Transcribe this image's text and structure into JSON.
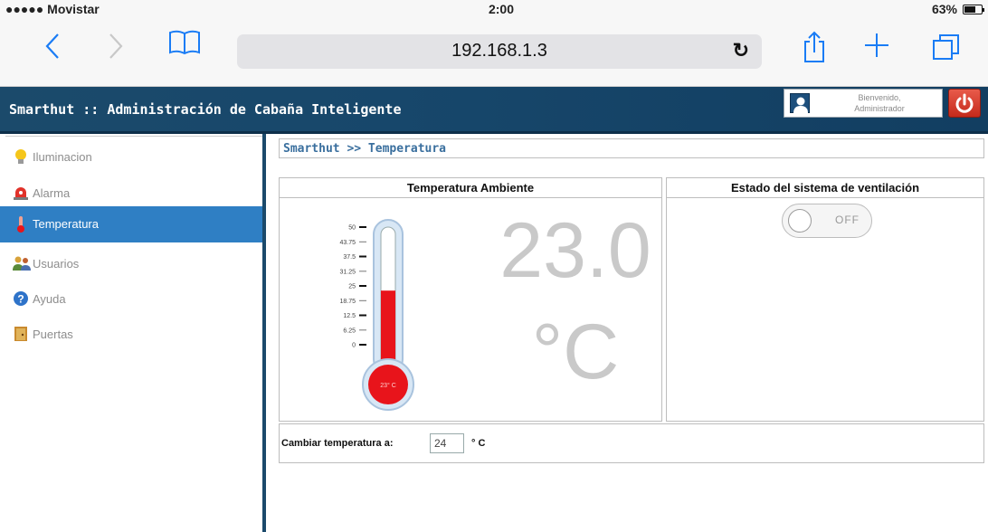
{
  "status": {
    "carrier": "●●●●● Movistar",
    "time": "2:00",
    "battery": "63%"
  },
  "browser": {
    "url": "192.168.1.3"
  },
  "header": {
    "title": "Smarthut :: Administración de Cabaña Inteligente",
    "welcome": "Bienvenido,",
    "user": "Administrador"
  },
  "sidebar": {
    "items": [
      {
        "label": "Iluminacion",
        "icon": "lightbulb-icon"
      },
      {
        "label": "Alarma",
        "icon": "alarm-icon"
      },
      {
        "label": "Temperatura",
        "icon": "thermometer-icon",
        "active": true
      },
      {
        "label": "Usuarios",
        "icon": "users-icon"
      },
      {
        "label": "Ayuda",
        "icon": "help-icon"
      },
      {
        "label": "Puertas",
        "icon": "door-icon"
      }
    ]
  },
  "breadcrumb": "Smarthut >> Temperatura",
  "temperature": {
    "heading": "Temperatura Ambiente",
    "value": "23.0",
    "unit": "°C",
    "bulb_label": "23° C",
    "reading": 23,
    "scale_max": 50,
    "ticks": [
      "50",
      "43.75",
      "37.5",
      "31.25",
      "25",
      "18.75",
      "12.5",
      "6.25",
      "0"
    ]
  },
  "ventilation": {
    "heading": "Estado del sistema de ventilación",
    "state": "OFF"
  },
  "change": {
    "label": "Cambiar temperatura a:",
    "value": "24",
    "unit": "° C"
  },
  "colors": {
    "header": "#1b4a6b",
    "active": "#2f7fc4",
    "mercury": "#e8141b"
  }
}
